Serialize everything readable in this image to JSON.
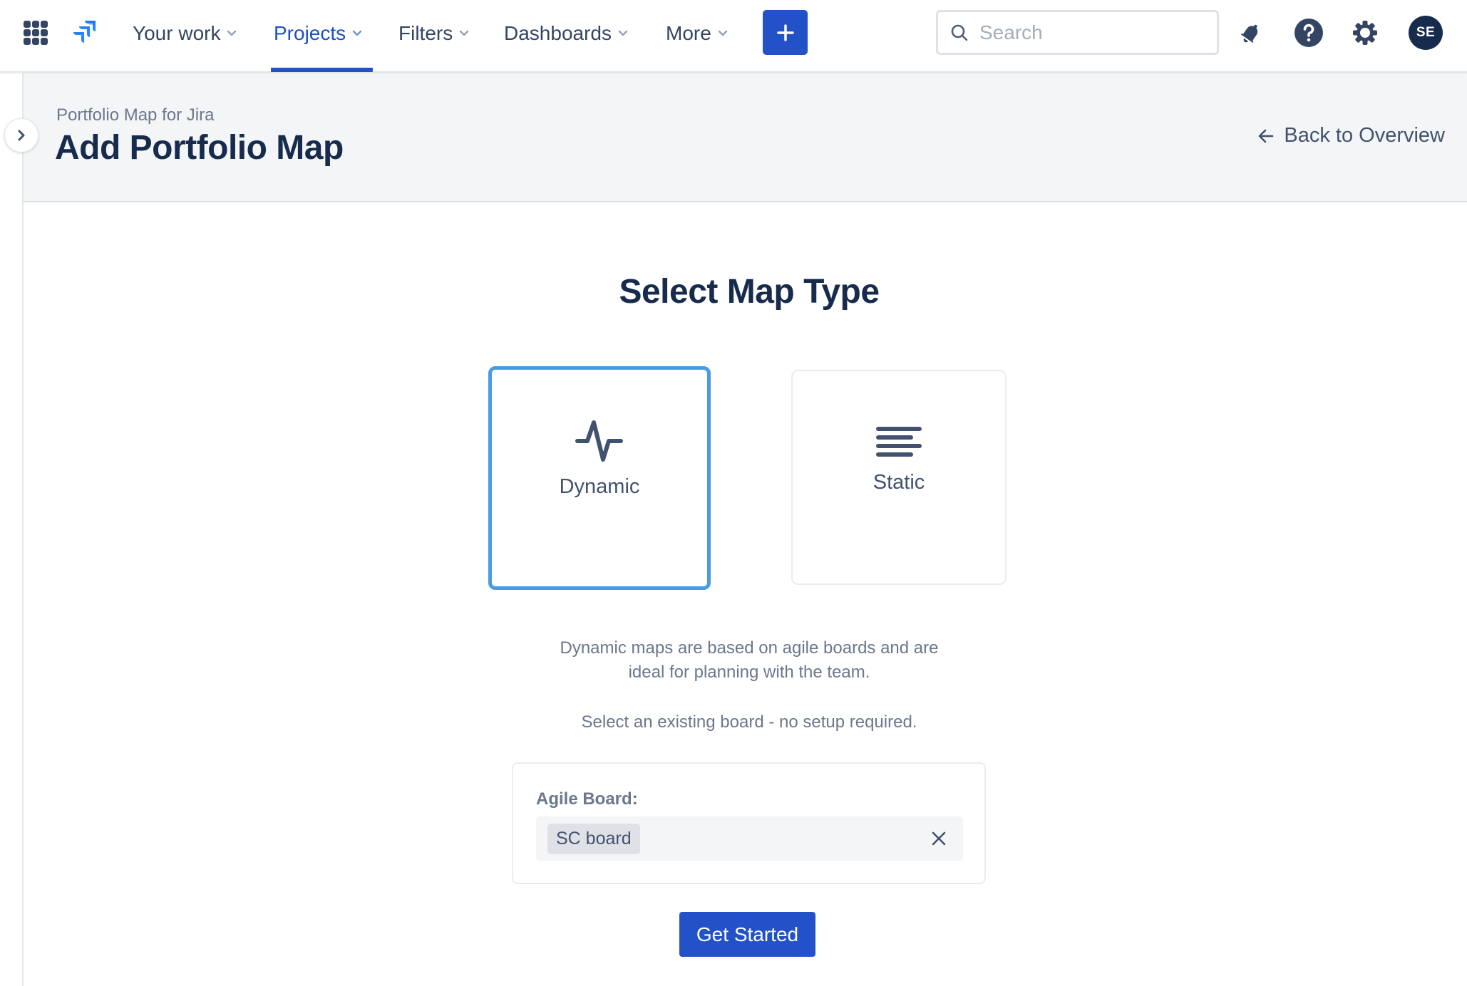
{
  "topnav": {
    "app_switcher_icon": "grid-icon",
    "logo_icon": "jira-logo-icon",
    "items": [
      {
        "label": "Your work",
        "active": false
      },
      {
        "label": "Projects",
        "active": true
      },
      {
        "label": "Filters",
        "active": false
      },
      {
        "label": "Dashboards",
        "active": false
      },
      {
        "label": "More",
        "active": false
      }
    ],
    "create_icon": "plus-icon",
    "search": {
      "placeholder": "Search",
      "value": ""
    },
    "notifications_icon": "bell-icon",
    "help_icon": "help-icon",
    "settings_icon": "gear-icon",
    "avatar_initials": "SE"
  },
  "colors": {
    "primary": "#2351C7",
    "selected_border": "#4C9AE4",
    "text_dark": "#172B4D",
    "text_muted": "#6B778C",
    "header_bg": "#F4F5F7"
  },
  "page_header": {
    "breadcrumb": "Portfolio Map for Jira",
    "title": "Add Portfolio Map",
    "back_link": "Back to Overview"
  },
  "main": {
    "section_title": "Select Map Type",
    "map_types": [
      {
        "label": "Dynamic",
        "icon": "activity-pulse-icon",
        "selected": true
      },
      {
        "label": "Static",
        "icon": "align-left-lines-icon",
        "selected": false
      }
    ],
    "description_lines": [
      "Dynamic maps are based on agile boards and are",
      "ideal for planning with the team."
    ],
    "hint": "Select an existing board - no setup required.",
    "board_field": {
      "label": "Agile Board:",
      "selected_value": "SC board"
    },
    "submit_label": "Get Started"
  }
}
